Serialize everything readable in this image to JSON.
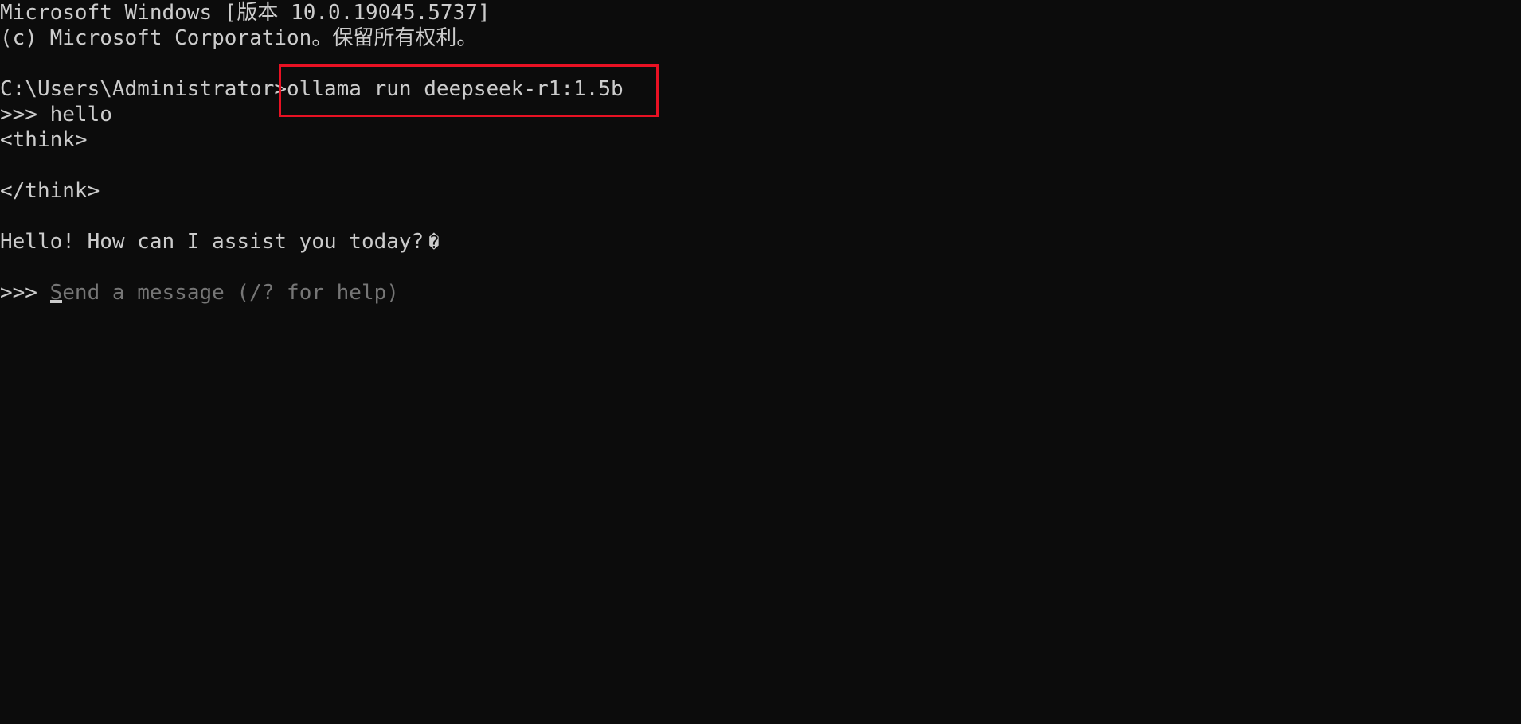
{
  "header": {
    "version_line": "Microsoft Windows [版本 10.0.19045.5737]",
    "copyright_line": "(c) Microsoft Corporation。保留所有权利。"
  },
  "command": {
    "prompt": "C:\\Users\\Administrator>",
    "text": "ollama run deepseek-r1:1.5b"
  },
  "chat": {
    "user_prompt_marker": ">>> ",
    "user_message": "hello",
    "think_open": "<think>",
    "think_close": "</think>",
    "assistant_reply": "Hello! How can I assist you today?",
    "reply_trailing_glyph": "�"
  },
  "input": {
    "prompt_marker": ">>> ",
    "cursor_char": "S",
    "placeholder_rest": "end a message (/? for help)"
  },
  "colors": {
    "background": "#0c0c0c",
    "foreground": "#cccccc",
    "placeholder": "#767676",
    "highlight_border": "#e81123"
  }
}
